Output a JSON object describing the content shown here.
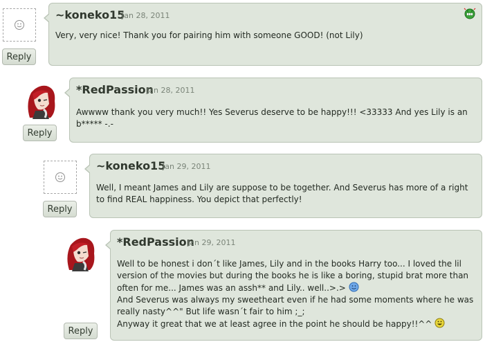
{
  "comments": [
    {
      "username": "~koneko15",
      "date": "Jan 28, 2011",
      "reply_label": "Reply",
      "avatar": "default-smiley-avatar",
      "badge_icon": "green-grin-emoticon-icon",
      "body": [
        "Very, very nice! Thank you for pairing him with someone GOOD! (not Lily)"
      ]
    },
    {
      "username": "*RedPassion",
      "date": "Jan 28, 2011",
      "reply_label": "Reply",
      "avatar": "red-haired-girl-avatar",
      "body": [
        "Awwww thank you very much!! Yes Severus deserve to be happy!!! <33333 And yes Lily is an b***** -.-"
      ]
    },
    {
      "username": "~koneko15",
      "date": "Jan 29, 2011",
      "reply_label": "Reply",
      "avatar": "default-smiley-avatar",
      "body": [
        "Well, I meant James and Lily are suppose to be together. And Severus has more of a right to find REAL happiness. You depict that perfectly!"
      ]
    },
    {
      "username": "*RedPassion",
      "date": "Jan 29, 2011",
      "reply_label": "Reply",
      "avatar": "red-haired-girl-avatar",
      "body": [
        "Well to be honest i don´t like James, Lily and in the books Harry too... I loved the lil version of the movies but during the books he is like a boring, stupid brat more than often for me... James was an assh** and Lily.. well..>.>",
        "And Severus was always my sweetheart even if he had some moments where he was really nasty^^\" But life wasn´t fair to him ;_;",
        "Anyway it great that we at least agree in the point he should be happy!!^^"
      ],
      "inline_icons": [
        "blue-smiley-emoticon-icon",
        "yellow-grin-emoticon-icon"
      ]
    }
  ]
}
